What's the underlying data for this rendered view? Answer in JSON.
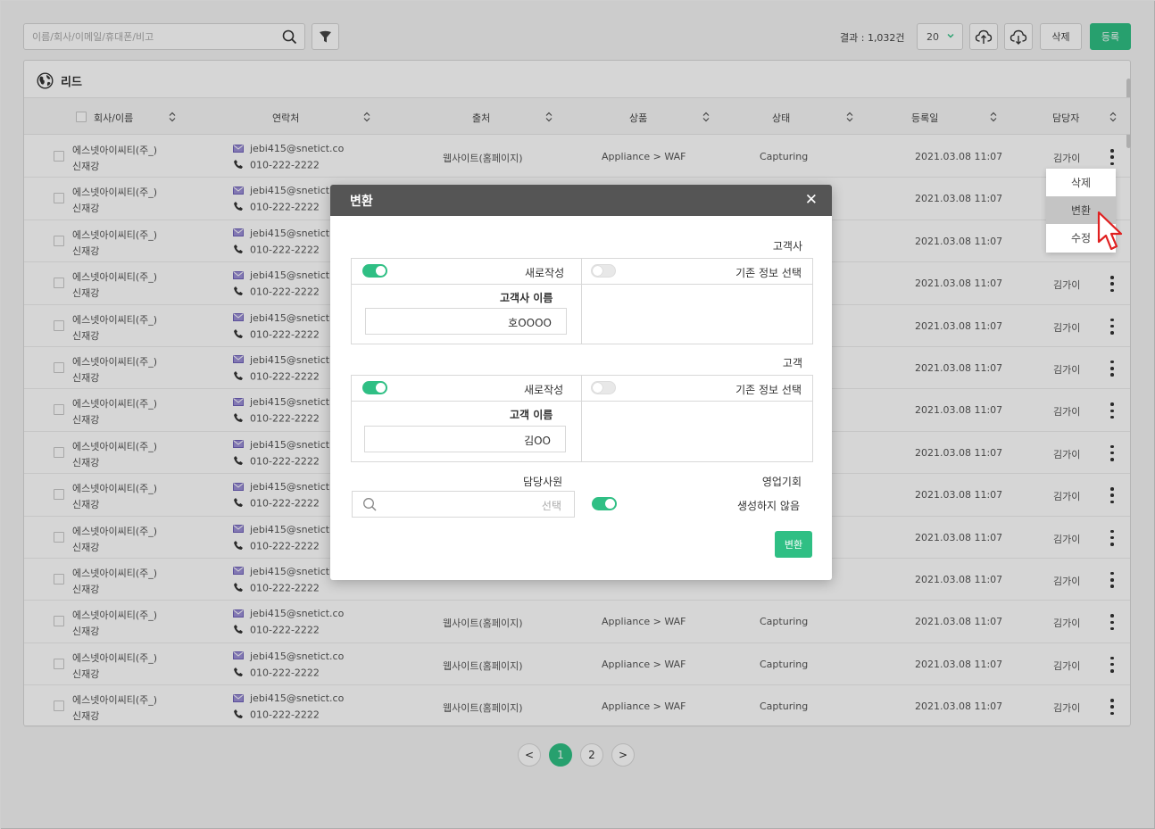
{
  "toolbar": {
    "search_placeholder": "이름/회사/이메일/휴대폰/비고",
    "result_label": "결과 : 1,032건",
    "page_size": "20",
    "delete_label": "삭제",
    "register_label": "등록"
  },
  "panel": {
    "title": "리드",
    "columns": [
      "회사/이름",
      "연락처",
      "출처",
      "상품",
      "상태",
      "등록일",
      "담당자"
    ]
  },
  "rows": [
    {
      "company": "에스넷아이씨티(주_)",
      "name": "신재강",
      "email": "jebi415@snetict.co",
      "phone": "010-222-2222",
      "source": "웹사이트(홈페이지)",
      "product": "Appliance > WAF",
      "status": "Capturing",
      "date": "2021.03.08 11:07",
      "owner": "김가이"
    },
    {
      "company": "에스넷아이씨티(주_)",
      "name": "신재강",
      "email": "jebi415@snetict.co",
      "phone": "010-222-2222",
      "source": "",
      "product": "",
      "status": "",
      "date": "2021.03.08 11:07",
      "owner": ""
    },
    {
      "company": "에스넷아이씨티(주_)",
      "name": "신재강",
      "email": "jebi415@snetict.co",
      "phone": "010-222-2222",
      "source": "",
      "product": "",
      "status": "",
      "date": "2021.03.08 11:07",
      "owner": ""
    },
    {
      "company": "에스넷아이씨티(주_)",
      "name": "신재강",
      "email": "jebi415@snetict.co",
      "phone": "010-222-2222",
      "source": "",
      "product": "",
      "status": "",
      "date": "2021.03.08 11:07",
      "owner": "김가이"
    },
    {
      "company": "에스넷아이씨티(주_)",
      "name": "신재강",
      "email": "jebi415@snetict.co",
      "phone": "010-222-2222",
      "source": "",
      "product": "",
      "status": "",
      "date": "2021.03.08 11:07",
      "owner": "김가이"
    },
    {
      "company": "에스넷아이씨티(주_)",
      "name": "신재강",
      "email": "jebi415@snetict.co",
      "phone": "010-222-2222",
      "source": "",
      "product": "",
      "status": "",
      "date": "2021.03.08 11:07",
      "owner": "김가이"
    },
    {
      "company": "에스넷아이씨티(주_)",
      "name": "신재강",
      "email": "jebi415@snetict.co",
      "phone": "010-222-2222",
      "source": "",
      "product": "",
      "status": "",
      "date": "2021.03.08 11:07",
      "owner": "김가이"
    },
    {
      "company": "에스넷아이씨티(주_)",
      "name": "신재강",
      "email": "jebi415@snetict.co",
      "phone": "010-222-2222",
      "source": "",
      "product": "",
      "status": "",
      "date": "2021.03.08 11:07",
      "owner": "김가이"
    },
    {
      "company": "에스넷아이씨티(주_)",
      "name": "신재강",
      "email": "jebi415@snetict.co",
      "phone": "010-222-2222",
      "source": "",
      "product": "",
      "status": "",
      "date": "2021.03.08 11:07",
      "owner": "김가이"
    },
    {
      "company": "에스넷아이씨티(주_)",
      "name": "신재강",
      "email": "jebi415@snetict.co",
      "phone": "010-222-2222",
      "source": "",
      "product": "",
      "status": "",
      "date": "2021.03.08 11:07",
      "owner": "김가이"
    },
    {
      "company": "에스넷아이씨티(주_)",
      "name": "신재강",
      "email": "jebi415@snetict.co",
      "phone": "010-222-2222",
      "source": "",
      "product": "",
      "status": "",
      "date": "2021.03.08 11:07",
      "owner": "김가이"
    },
    {
      "company": "에스넷아이씨티(주_)",
      "name": "신재강",
      "email": "jebi415@snetict.co",
      "phone": "010-222-2222",
      "source": "웹사이트(홈페이지)",
      "product": "Appliance > WAF",
      "status": "Capturing",
      "date": "2021.03.08 11:07",
      "owner": "김가이"
    },
    {
      "company": "에스넷아이씨티(주_)",
      "name": "신재강",
      "email": "jebi415@snetict.co",
      "phone": "010-222-2222",
      "source": "웹사이트(홈페이지)",
      "product": "Appliance > WAF",
      "status": "Capturing",
      "date": "2021.03.08 11:07",
      "owner": "김가이"
    },
    {
      "company": "에스넷아이씨티(주_)",
      "name": "신재강",
      "email": "jebi415@snetict.co",
      "phone": "010-222-2222",
      "source": "웹사이트(홈페이지)",
      "product": "Appliance > WAF",
      "status": "Capturing",
      "date": "2021.03.08 11:07",
      "owner": "김가이"
    }
  ],
  "pagination": {
    "prev": "<",
    "pages": [
      "1",
      "2"
    ],
    "next": ">",
    "current": "1"
  },
  "context_menu": {
    "items": [
      "삭제",
      "변환",
      "수정"
    ],
    "hovered": "변환"
  },
  "modal": {
    "title": "변환",
    "close": "✕",
    "customer_company": {
      "section_title": "고객사",
      "new_label": "새로작성",
      "existing_label": "기존 정보 선택",
      "name_label": "고객사 이름",
      "name_value": "호OOOO",
      "new_on": true,
      "existing_on": false
    },
    "customer": {
      "section_title": "고객",
      "new_label": "새로작성",
      "existing_label": "기존 정보 선택",
      "name_label": "고객 이름",
      "name_value": "김OO",
      "new_on": true,
      "existing_on": false
    },
    "employee": {
      "label": "담당사원",
      "placeholder": "선택"
    },
    "opportunity": {
      "label": "영업기회",
      "toggle_label": "생성하지 않음",
      "on": true
    },
    "convert_label": "변환"
  },
  "colors": {
    "accent": "#2fbf84",
    "header_dark": "#555555",
    "overlay": "rgba(0,0,0,0.16)"
  }
}
